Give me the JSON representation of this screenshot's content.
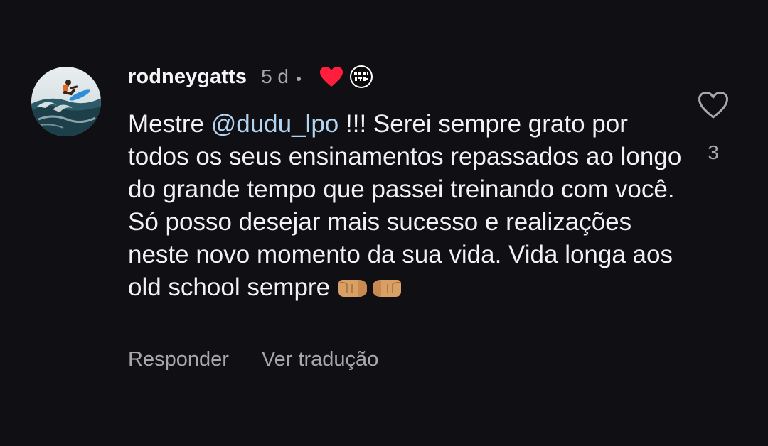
{
  "comment": {
    "username": "rodneygatts",
    "timestamp": "5 d",
    "creator_liked_icon": "red-heart-icon",
    "creator_avatar_icon": "profile-avatar-icon",
    "body": {
      "before_mention": "Mestre ",
      "mention": "@dudu_lpo",
      "after_mention": " !!! Serei sempre grato por todos os seus ensinamentos repassados ao longo do grande tempo que passei treinando com você. Só posso desejar mais sucesso e realizações neste novo momento da sua vida. Vida longa aos old school sempre",
      "emoji_icon": "fist-bump-icon"
    },
    "actions": {
      "reply_label": "Responder",
      "translate_label": "Ver tradução"
    },
    "like": {
      "icon": "heart-outline-icon",
      "count": "3"
    }
  },
  "colors": {
    "background": "#0f0f14",
    "text": "#f2f2f2",
    "secondary_text": "#a8a8a8",
    "mention": "#b3d4f0",
    "heart_red": "#ff1f3d"
  }
}
